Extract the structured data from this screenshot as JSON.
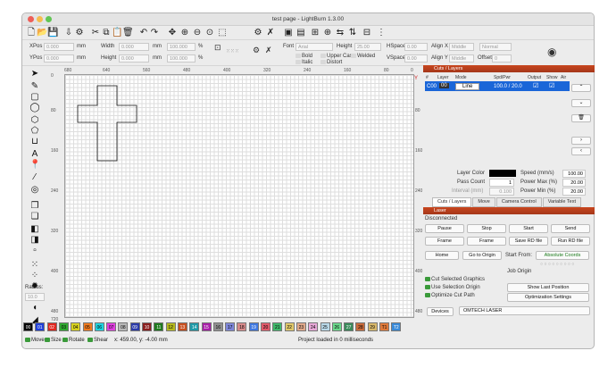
{
  "window": {
    "title": "test page - LightBurn 1.3.00"
  },
  "traffic_lights": [
    "#ed5f58",
    "#f5bd4f",
    "#61c554"
  ],
  "toolbar_icons": [
    {
      "name": "new-file-icon",
      "glyph": "🗋"
    },
    {
      "name": "open-folder-icon",
      "glyph": "📂"
    },
    {
      "name": "save-icon",
      "glyph": "💾"
    },
    {
      "name": "import-icon",
      "glyph": "⇩"
    },
    {
      "name": "settings-icon",
      "glyph": "⚙"
    },
    {
      "name": "scissors-icon",
      "glyph": "✂"
    },
    {
      "name": "copy-icon",
      "glyph": "⧉"
    },
    {
      "name": "paste-icon",
      "glyph": "📋"
    },
    {
      "name": "trash-icon",
      "glyph": "🗑"
    },
    {
      "name": "undo-icon",
      "glyph": "↶"
    },
    {
      "name": "redo-icon",
      "glyph": "↷"
    },
    {
      "name": "move-icon",
      "glyph": "✥"
    },
    {
      "name": "zoom-in-icon",
      "glyph": "⊕"
    },
    {
      "name": "zoom-out-icon",
      "glyph": "⊖"
    },
    {
      "name": "zoom-frame-icon",
      "glyph": "⊙"
    },
    {
      "name": "zoom-select-icon",
      "glyph": "⬚"
    },
    {
      "name": "machine-settings-icon",
      "glyph": "⚙"
    },
    {
      "name": "tools-icon",
      "glyph": "✗"
    },
    {
      "name": "group-icon",
      "glyph": "▣"
    },
    {
      "name": "ungroup-icon",
      "glyph": "▤"
    },
    {
      "name": "align-icon",
      "glyph": "⊞"
    },
    {
      "name": "center-icon",
      "glyph": "⊕"
    },
    {
      "name": "flip-h-icon",
      "glyph": "⇆"
    },
    {
      "name": "flip-v-icon",
      "glyph": "⇅"
    },
    {
      "name": "distribute-icon",
      "glyph": "⊟"
    },
    {
      "name": "array-icon",
      "glyph": "⋮"
    }
  ],
  "numeric_edit": {
    "xpos_label": "XPos",
    "xpos_value": "0.000",
    "xpos_unit": "mm",
    "ypos_label": "YPos",
    "ypos_value": "0.000",
    "ypos_unit": "mm",
    "width_label": "Width",
    "width_value": "0.000",
    "width_unit": "mm",
    "width_pct": "100.000",
    "width_pct_unit": "%",
    "height_label": "Height",
    "height_value": "0.000",
    "height_unit": "mm",
    "height_pct": "100.000",
    "height_pct_unit": "%"
  },
  "text_options": {
    "font_label": "Font",
    "font_value": "Arial",
    "height_label": "Height",
    "height_value": "25.00",
    "hspace_label": "HSpace",
    "hspace_value": "0.00",
    "vspace_label": "VSpace",
    "vspace_value": "0.00",
    "alignx_label": "Align X",
    "alignx_value": "Middle",
    "aligny_label": "Align Y",
    "aligny_value": "Middle",
    "style_value": "Normal",
    "offset_label": "Offset",
    "offset_value": "0",
    "bold": "Bold",
    "italic": "Italic",
    "upper_case": "Upper Case",
    "distort": "Distort",
    "welded": "Welded"
  },
  "left_tools": [
    {
      "name": "select-arrow-icon",
      "glyph": "➤"
    },
    {
      "name": "edit-pencil-icon",
      "glyph": "✎"
    },
    {
      "name": "rectangle-icon",
      "glyph": "▢"
    },
    {
      "name": "ellipse-icon",
      "glyph": "◯"
    },
    {
      "name": "polygon-icon",
      "glyph": "⬡"
    },
    {
      "name": "polygon-alt-icon",
      "glyph": "⬠"
    },
    {
      "name": "measure-icon",
      "glyph": "⊔"
    },
    {
      "name": "text-icon",
      "glyph": "A"
    },
    {
      "name": "position-pin-icon",
      "glyph": "📍"
    },
    {
      "name": "laser-tool-icon",
      "glyph": "⁄"
    },
    {
      "name": "offset-icon",
      "glyph": "◎"
    },
    {
      "name": "weld-icon",
      "glyph": "❐"
    },
    {
      "name": "boolean-union-icon",
      "glyph": "❏"
    },
    {
      "name": "boolean-subtract-icon",
      "glyph": "◧"
    },
    {
      "name": "boolean-intersect-icon",
      "glyph": "◨"
    },
    {
      "name": "boolean-small-icon",
      "glyph": "▫"
    },
    {
      "name": "grid-array-icon",
      "glyph": "⁙"
    },
    {
      "name": "grid-dots-icon",
      "glyph": "⁘"
    },
    {
      "name": "circular-array-icon",
      "glyph": "✹"
    },
    {
      "name": "node-edit-icon",
      "glyph": "◖"
    },
    {
      "name": "corner-icon",
      "glyph": "◢"
    }
  ],
  "radius": {
    "label": "Radius:",
    "value": "10.0"
  },
  "ruler": {
    "top": [
      "680",
      "640",
      "560",
      "480",
      "400",
      "320",
      "240",
      "160",
      "80",
      "0"
    ],
    "left": [
      "0",
      "80",
      "160",
      "240",
      "320",
      "400",
      "480",
      "720"
    ],
    "right": [
      "80",
      "160",
      "240",
      "320",
      "400",
      "480"
    ],
    "y_label": "Y"
  },
  "cuts_panel": {
    "title": "Cuts / Layers",
    "headers": [
      "#",
      "Layer",
      "Mode",
      "Spd/Pwr",
      "Output",
      "Show",
      "Air"
    ],
    "row": {
      "id": "C00",
      "layer": "00",
      "mode": "Line",
      "spd_pwr": "100.0 / 20.0"
    },
    "layer_color_label": "Layer Color",
    "layer_color": "#000000",
    "pass_count_label": "Pass Count",
    "pass_count": "1",
    "interval_label": "Interval (mm)",
    "interval": "0.100",
    "speed_label": "Speed (mm/s)",
    "speed": "100.00",
    "power_max_label": "Power Max (%)",
    "power_max": "20.00",
    "power_min_label": "Power Min (%)",
    "power_min": "20.00",
    "side_buttons": [
      "⌃",
      "⌄",
      "🗑",
      "›",
      "‹"
    ]
  },
  "tabs": [
    "Cuts / Layers",
    "Move",
    "Camera Control",
    "Variable Text"
  ],
  "laser_panel": {
    "title": "Laser",
    "status": "Disconnected",
    "pause": "Pause",
    "stop": "Stop",
    "start": "Start",
    "send": "Send",
    "frame1": "Frame",
    "frame2": "Frame",
    "save_rd": "Save RD file",
    "run_rd": "Run RD file",
    "home": "Home",
    "go_to_origin": "Go to Origin",
    "start_from_label": "Start From:",
    "start_from_value": "Absolute Coords",
    "job_origin_label": "Job Origin",
    "cut_selected": "Cut Selected Graphics",
    "use_selection_origin": "Use Selection Origin",
    "optimize_cut_path": "Optimize Cut Path",
    "show_last_position": "Show Last Position",
    "optimization_settings": "Optimization Settings",
    "devices": "Devices",
    "device_value": "OMTECH LASER"
  },
  "palette": [
    {
      "label": "00",
      "color": "#000000",
      "text": "#ffffff"
    },
    {
      "label": "01",
      "color": "#1f3fd8",
      "text": "#ffffff"
    },
    {
      "label": "02",
      "color": "#e0261f",
      "text": "#ffffff"
    },
    {
      "label": "03",
      "color": "#2fa82f",
      "text": "#000000"
    },
    {
      "label": "04",
      "color": "#d7d11f",
      "text": "#000000"
    },
    {
      "label": "05",
      "color": "#f07a1f",
      "text": "#000000"
    },
    {
      "label": "06",
      "color": "#1fd3e0",
      "text": "#000000"
    },
    {
      "label": "07",
      "color": "#e03fe0",
      "text": "#000000"
    },
    {
      "label": "08",
      "color": "#b9b9b9",
      "text": "#000000"
    },
    {
      "label": "09",
      "color": "#2b3ba8",
      "text": "#ffffff"
    },
    {
      "label": "10",
      "color": "#8a1f1f",
      "text": "#ffffff"
    },
    {
      "label": "11",
      "color": "#1f7a1f",
      "text": "#ffffff"
    },
    {
      "label": "12",
      "color": "#b5b81f",
      "text": "#000000"
    },
    {
      "label": "13",
      "color": "#c84f1f",
      "text": "#ffffff"
    },
    {
      "label": "14",
      "color": "#1f9aa8",
      "text": "#ffffff"
    },
    {
      "label": "15",
      "color": "#a81fa8",
      "text": "#ffffff"
    },
    {
      "label": "16",
      "color": "#8f8f8f",
      "text": "#000000"
    },
    {
      "label": "17",
      "color": "#7e86d8",
      "text": "#000000"
    },
    {
      "label": "18",
      "color": "#d88a8a",
      "text": "#000000"
    },
    {
      "label": "19",
      "color": "#3f78e0",
      "text": "#ffffff"
    },
    {
      "label": "20",
      "color": "#e05a6a",
      "text": "#000000"
    },
    {
      "label": "21",
      "color": "#3fb86a",
      "text": "#000000"
    },
    {
      "label": "22",
      "color": "#e0c86a",
      "text": "#000000"
    },
    {
      "label": "23",
      "color": "#e0a88a",
      "text": "#000000"
    },
    {
      "label": "24",
      "color": "#e8a8d8",
      "text": "#000000"
    },
    {
      "label": "25",
      "color": "#b8d8e8",
      "text": "#000000"
    },
    {
      "label": "26",
      "color": "#6ad88a",
      "text": "#000000"
    },
    {
      "label": "27",
      "color": "#3a8a5a",
      "text": "#ffffff"
    },
    {
      "label": "28",
      "color": "#c86a3a",
      "text": "#000000"
    },
    {
      "label": "29",
      "color": "#d8b86a",
      "text": "#000000"
    },
    {
      "label": "T1",
      "color": "#e07a3a",
      "text": "#000000"
    },
    {
      "label": "T2",
      "color": "#3a8ad8",
      "text": "#ffffff"
    }
  ],
  "status_bar": {
    "move": "Move",
    "size": "Size",
    "rotate": "Rotate",
    "shear": "Shear",
    "coords": "x: 459.00, y: -4.00 mm",
    "message": "Project loaded in 0 milliseconds"
  }
}
